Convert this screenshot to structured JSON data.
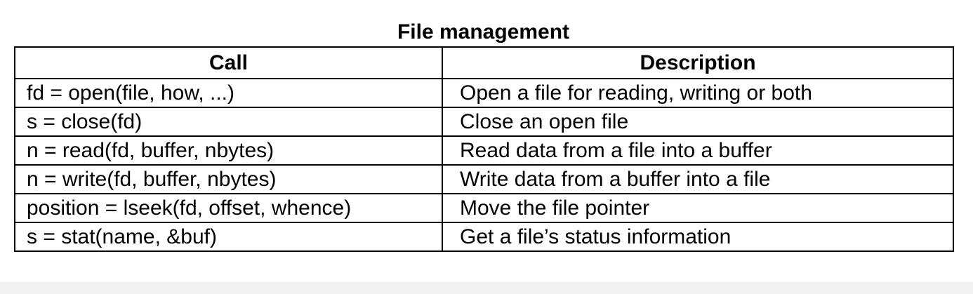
{
  "title": "File management",
  "columns": {
    "call": "Call",
    "description": "Description"
  },
  "rows": [
    {
      "call": "fd = open(file, how, ...)",
      "description": "Open a file for reading, writing or both"
    },
    {
      "call": "s = close(fd)",
      "description": "Close an open file"
    },
    {
      "call": "n = read(fd, buffer, nbytes)",
      "description": "Read data from a file into a buffer"
    },
    {
      "call": "n = write(fd, buffer, nbytes)",
      "description": "Write data from a buffer into a file"
    },
    {
      "call": "position = lseek(fd, offset, whence)",
      "description": "Move the file pointer"
    },
    {
      "call": "s = stat(name, &buf)",
      "description": "Get a file’s status information"
    }
  ]
}
